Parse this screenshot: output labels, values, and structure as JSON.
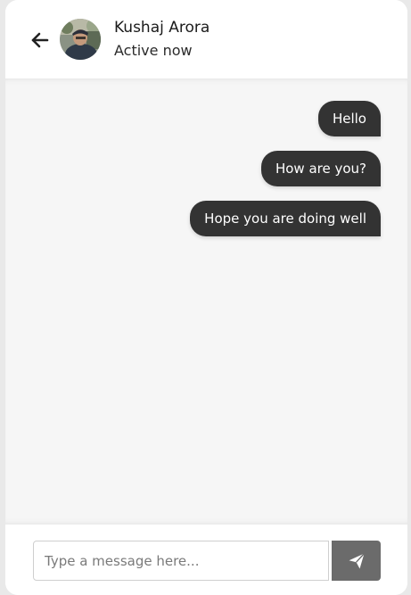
{
  "header": {
    "back_icon": "arrow-left-icon",
    "avatar_icon": "user-avatar",
    "contact_name": "Kushaj Arora",
    "contact_status": "Active now"
  },
  "messages": [
    {
      "text": "Hello",
      "direction": "outgoing"
    },
    {
      "text": "How are you?",
      "direction": "outgoing"
    },
    {
      "text": "Hope you are doing well",
      "direction": "outgoing"
    }
  ],
  "composer": {
    "placeholder": "Type a message here...",
    "value": "",
    "send_icon": "paper-plane-icon"
  },
  "colors": {
    "bubble_bg": "#333333",
    "bubble_text": "#ffffff",
    "chat_bg": "#f6f6f6",
    "send_button": "#6b6b6b"
  }
}
